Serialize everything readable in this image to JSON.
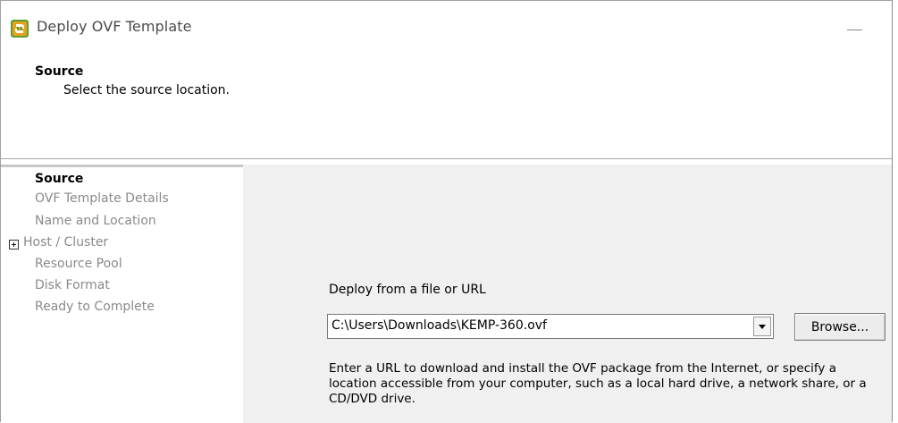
{
  "window": {
    "title": "Deploy OVF Template",
    "icon": "vsphere-app-icon"
  },
  "header": {
    "title": "Source",
    "subtitle": "Select the source location."
  },
  "nav": {
    "items": [
      {
        "label": "Source",
        "active": true
      },
      {
        "label": "OVF Template Details",
        "active": false
      },
      {
        "label": "Name and Location",
        "active": false
      },
      {
        "label": "Host / Cluster",
        "active": false,
        "expandable": true
      },
      {
        "label": "Resource Pool",
        "active": false
      },
      {
        "label": "Disk Format",
        "active": false
      },
      {
        "label": "Ready to Complete",
        "active": false
      }
    ]
  },
  "content": {
    "deploy_label": "Deploy from a file or URL",
    "source_value": "C:\\Users\\Downloads\\KEMP-360.ovf",
    "browse_label": "Browse...",
    "help_text": "Enter a URL to download and install the OVF package from the Internet, or specify a location accessible from your computer, such as a local hard drive, a network share, or a CD/DVD drive."
  },
  "colors": {
    "accent_orange": "#e8a020",
    "accent_green": "#5a9e2f",
    "nav_inactive": "#8a8a8a",
    "content_bg": "#f0f0f0"
  }
}
